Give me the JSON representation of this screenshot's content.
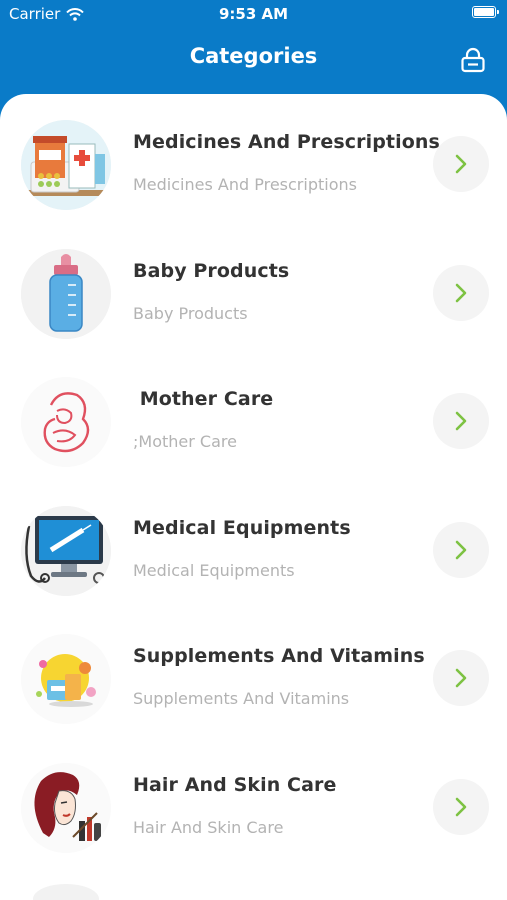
{
  "status_bar": {
    "carrier": "Carrier",
    "time": "9:53 AM"
  },
  "header": {
    "title": "Categories",
    "lock_icon": "lock-icon"
  },
  "colors": {
    "primary": "#0a7bc8",
    "chevron": "#7dc242",
    "title_text": "#333333",
    "subtitle_text": "#b3b3b3"
  },
  "categories": [
    {
      "name": "Medicines And Prescriptions",
      "subtitle": "Medicines And Prescriptions",
      "icon": "medicines-icon"
    },
    {
      "name": "Baby Products",
      "subtitle": "Baby Products",
      "icon": "baby-bottle-icon"
    },
    {
      "name": " Mother Care",
      "subtitle": ";Mother Care",
      "icon": "mother-baby-icon"
    },
    {
      "name": "Medical Equipments",
      "subtitle": "Medical Equipments",
      "icon": "monitor-syringe-icon"
    },
    {
      "name": "Supplements And Vitamins",
      "subtitle": "Supplements And Vitamins",
      "icon": "supplements-icon"
    },
    {
      "name": "Hair And Skin Care",
      "subtitle": "Hair And Skin Care",
      "icon": "woman-face-icon"
    }
  ]
}
